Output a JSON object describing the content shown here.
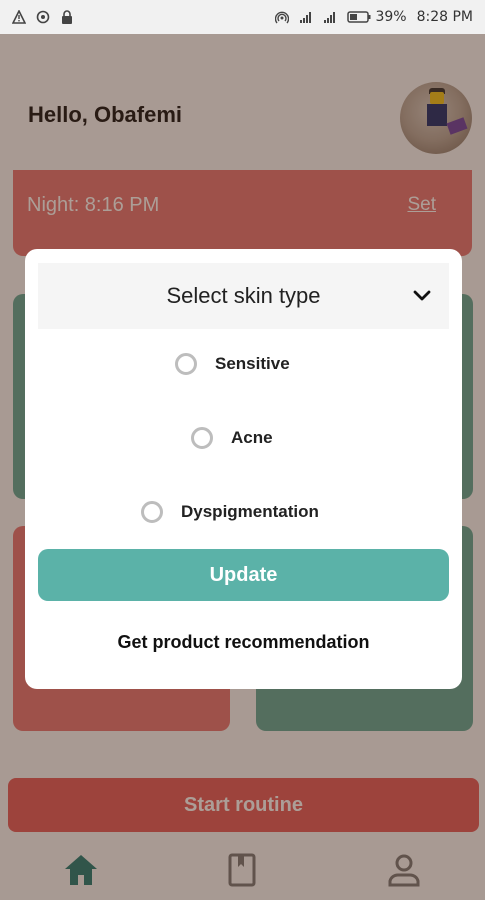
{
  "status_bar": {
    "battery": "39%",
    "time": "8:28 PM",
    "left_icons": [
      "warning-icon",
      "target-icon",
      "lock-icon"
    ],
    "right_icons": [
      "hotspot-icon",
      "signal-4g-icon",
      "signal-icon",
      "battery-icon"
    ]
  },
  "header": {
    "greeting": "Hello, Obafemi"
  },
  "night_card": {
    "text": "Night: 8:16 PM",
    "set_label": "Set"
  },
  "modal": {
    "select_label": "Select skin type",
    "options": [
      {
        "label": "Sensitive"
      },
      {
        "label": "Acne"
      },
      {
        "label": "Dyspigmentation"
      }
    ],
    "update_label": "Update",
    "recommendation_label": "Get product recommendation"
  },
  "start_label": "Start routine",
  "bottom_nav": [
    "home-icon",
    "book-icon",
    "profile-icon"
  ],
  "colors": {
    "teal": "#5bb2a8",
    "coral": "#e35a5a",
    "scrim": "#46281973"
  }
}
